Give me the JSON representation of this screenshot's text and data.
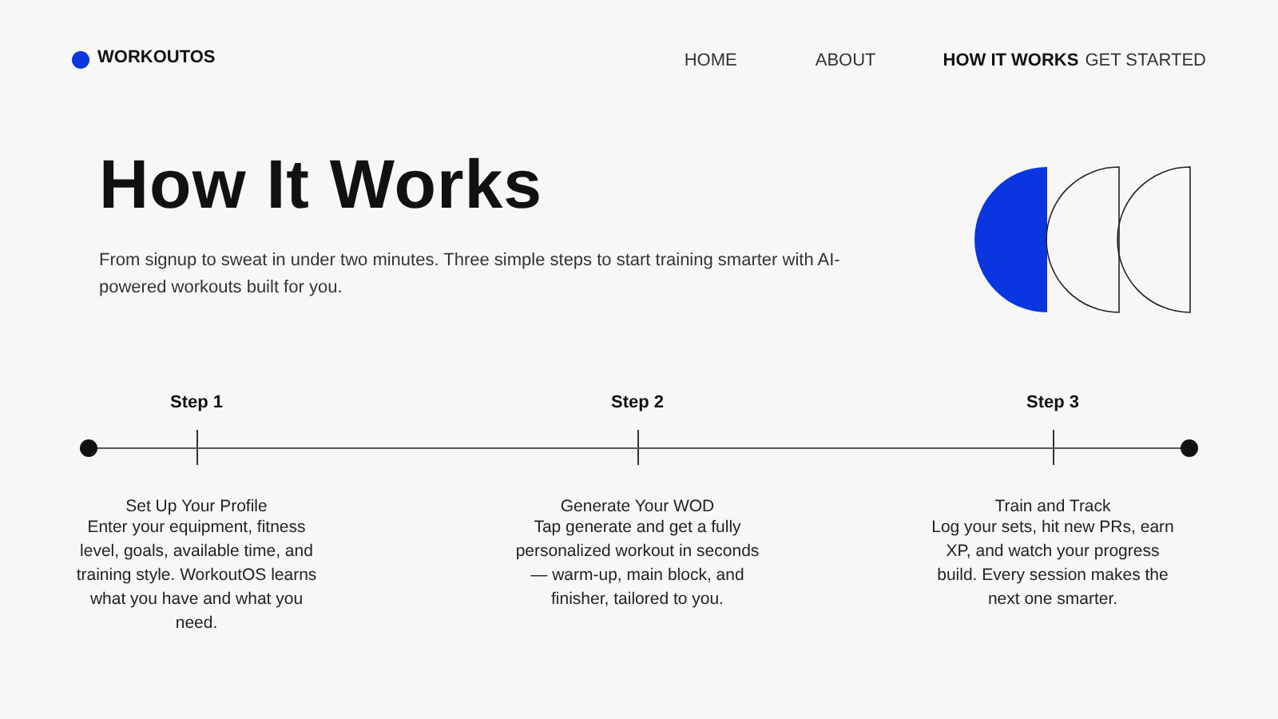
{
  "brand": {
    "name": "WORKOUTOS"
  },
  "nav": [
    {
      "label": "HOME",
      "selected": false
    },
    {
      "label": "ABOUT",
      "selected": false
    },
    {
      "label": "HOW IT WORKS",
      "selected": true
    },
    {
      "label": "GET STARTED",
      "selected": false
    }
  ],
  "hero": {
    "title": "How It Works",
    "subtitle": "From signup to sweat in under two minutes. Three simple steps to start training smarter with AI-powered workouts built for you."
  },
  "steps": [
    {
      "label": "Step 1",
      "title": "Set Up Your Profile",
      "text": "Enter your equipment, fitness level, goals, available time, and training style. WorkoutOS learns what you have and what you need."
    },
    {
      "label": "Step 2",
      "title": "Generate Your WOD",
      "text": "Tap generate and get a fully personalized workout in seconds — warm-up, main block, and finisher, tailored to you."
    },
    {
      "label": "Step 3",
      "title": "Train and Track",
      "text": "Log your sets, hit new PRs, earn XP, and watch your progress build. Every session makes the next one smarter."
    }
  ]
}
